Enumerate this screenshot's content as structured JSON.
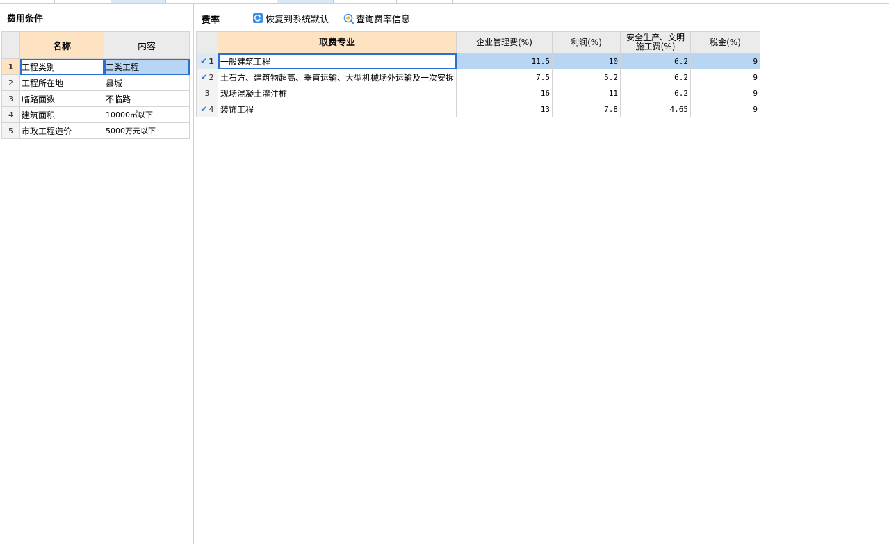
{
  "left": {
    "title": "费用条件",
    "headers": {
      "name": "名称",
      "content": "内容"
    },
    "rows": [
      {
        "no": "1",
        "name": "工程类别",
        "content": "三类工程"
      },
      {
        "no": "2",
        "name": "工程所在地",
        "content": "县城"
      },
      {
        "no": "3",
        "name": "临路面数",
        "content": "不临路"
      },
      {
        "no": "4",
        "name": "建筑面积",
        "content": "10000㎡以下"
      },
      {
        "no": "5",
        "name": "市政工程造价",
        "content": "5000万元以下"
      }
    ]
  },
  "right": {
    "title": "费率",
    "toolbar": {
      "restore_label": "恢复到系统默认",
      "query_label": "查询费率信息"
    },
    "headers": {
      "specialty": "取费专业",
      "mgmt": "企业管理费(%)",
      "profit": "利润(%)",
      "safety": "安全生产、文明施工费(%)",
      "tax": "税金(%)"
    },
    "rows": [
      {
        "no": "1",
        "checked": true,
        "specialty": "一般建筑工程",
        "mgmt": "11.5",
        "profit": "10",
        "safety": "6.2",
        "tax": "9"
      },
      {
        "no": "2",
        "checked": true,
        "specialty": "土石方、建筑物超高、垂直运输、大型机械场外运输及一次安拆",
        "mgmt": "7.5",
        "profit": "5.2",
        "safety": "6.2",
        "tax": "9"
      },
      {
        "no": "3",
        "checked": false,
        "specialty": "现场混凝土灌注桩",
        "mgmt": "16",
        "profit": "11",
        "safety": "6.2",
        "tax": "9"
      },
      {
        "no": "4",
        "checked": true,
        "specialty": "装饰工程",
        "mgmt": "13",
        "profit": "7.8",
        "safety": "4.65",
        "tax": "9"
      }
    ]
  },
  "colors": {
    "header_highlight": "#fde3c1",
    "selection_blue": "#b9d5f4",
    "accent_blue": "#2a6fd6"
  }
}
